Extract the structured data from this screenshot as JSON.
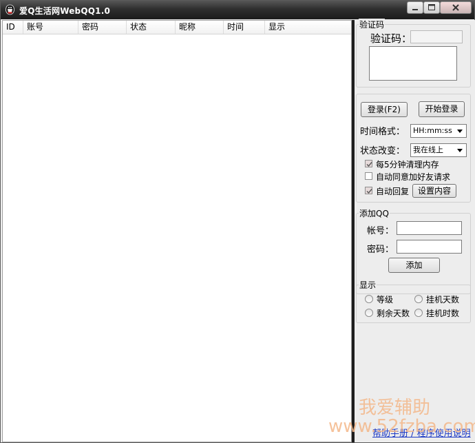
{
  "window": {
    "title": "爱Q生活网WebQQ1.0",
    "controls": {
      "minimize": "minimize",
      "maximize": "maximize",
      "close": "close"
    }
  },
  "accounts_table": {
    "columns": [
      "ID",
      "账号",
      "密码",
      "状态",
      "昵称",
      "时间",
      "显示"
    ],
    "rows": []
  },
  "captcha_group": {
    "title": "验证码",
    "label": "验证码：",
    "input_value": ""
  },
  "settings_group": {
    "login_button": "登录(F2)",
    "start_login_button": "开始登录",
    "time_format_label": "时间格式：",
    "time_format_value": "HH:mm:ss",
    "status_change_label": "状态改变：",
    "status_change_value": "我在线上",
    "options": [
      {
        "label": "每5分钟清理内存",
        "checked": true
      },
      {
        "label": "自动同意加好友请求",
        "checked": false
      },
      {
        "label": "自动回复",
        "checked": true
      }
    ],
    "set_content_button": "设置内容"
  },
  "add_qq_group": {
    "title": "添加QQ",
    "account_label": "帐号：",
    "account_value": "",
    "password_label": "密码：",
    "password_value": "",
    "add_button": "添加"
  },
  "display_group": {
    "title": "显示",
    "options": [
      "等级",
      "挂机天数",
      "剩余天数",
      "挂机时数"
    ]
  },
  "watermark": {
    "line1": "我爱辅助",
    "line2": "www.52fzba.com"
  },
  "bottom_link": {
    "text": "帮助手册 / 程序使用说明"
  },
  "colors": {
    "titlebar": "#2f2f2f",
    "watermark": "#f4b88a",
    "link": "#1a37c4"
  }
}
